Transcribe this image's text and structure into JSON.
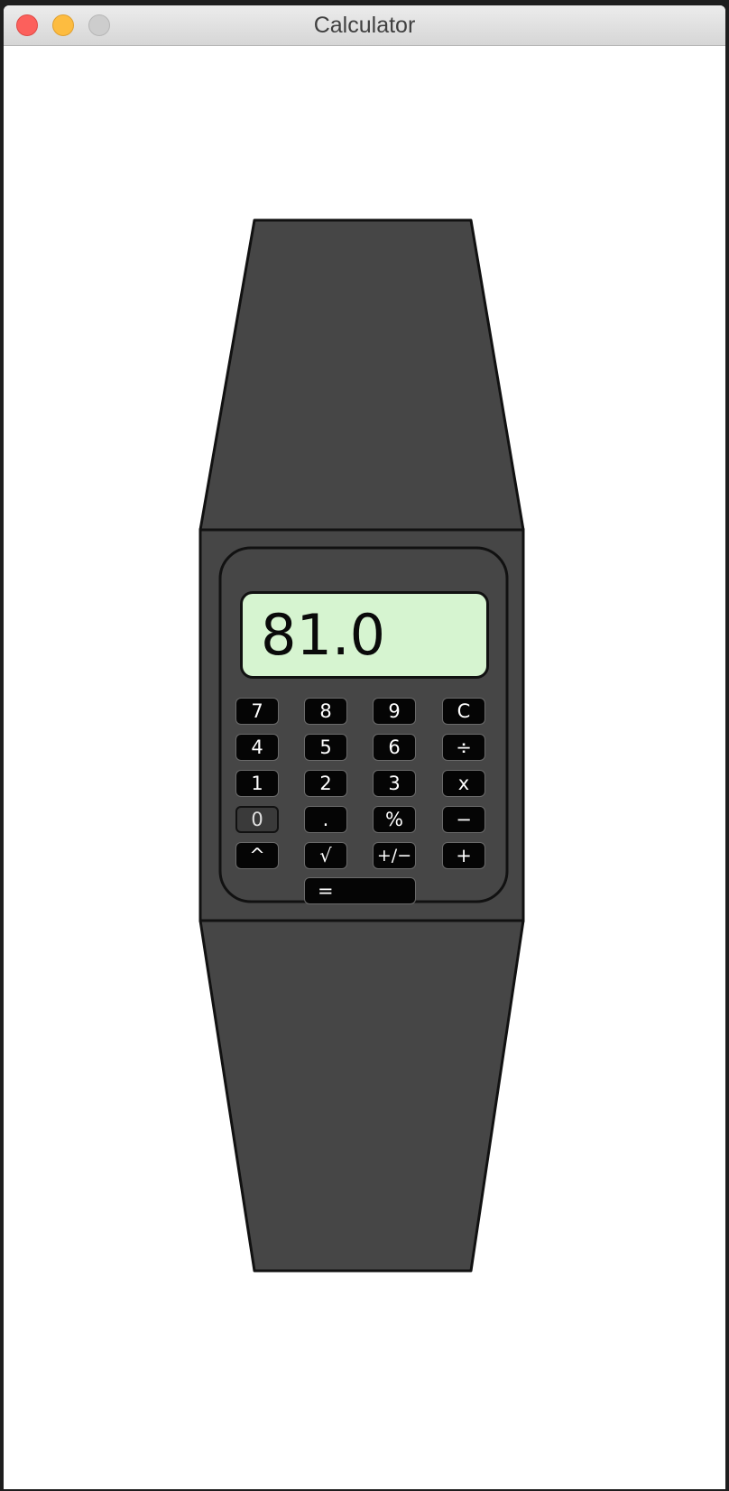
{
  "window": {
    "title": "Calculator"
  },
  "colors": {
    "case": "#464646",
    "display_background": "#d6f4d0",
    "key_background": "#050505"
  },
  "display": {
    "value": "81.0"
  },
  "keys": {
    "seven": "7",
    "eight": "8",
    "nine": "9",
    "clear": "C",
    "four": "4",
    "five": "5",
    "six": "6",
    "divide": "÷",
    "one": "1",
    "two": "2",
    "three": "3",
    "multiply": "x",
    "zero": "0",
    "decimal": ".",
    "percent": "%",
    "subtract": "−",
    "power": "^",
    "sqrt": "√",
    "negate": "+/−",
    "add": "+",
    "equals": "="
  }
}
